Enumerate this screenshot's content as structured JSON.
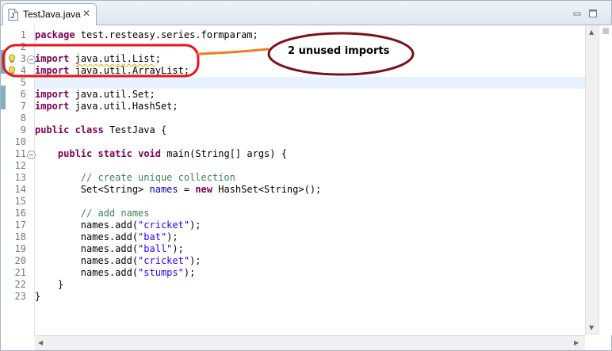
{
  "tab": {
    "title": "TestJava.java",
    "icon": "java-file-icon",
    "close_glyph": "✕"
  },
  "window_controls": [
    "minimize-icon",
    "maximize-icon"
  ],
  "gutter": {
    "warning_lines": [
      3,
      4
    ],
    "fold_lines": [
      3,
      11
    ],
    "current_line": 5
  },
  "code_lines": [
    {
      "n": "1",
      "segments": [
        {
          "text": "package",
          "cls": "kw"
        },
        {
          "text": " test.resteasy.series.formparam;",
          "cls": ""
        }
      ]
    },
    {
      "n": "2",
      "segments": []
    },
    {
      "n": "3",
      "segments": [
        {
          "text": "import",
          "cls": "kw"
        },
        {
          "text": " ",
          "cls": ""
        },
        {
          "text": "java.util.List",
          "cls": "unused"
        },
        {
          "text": ";",
          "cls": ""
        }
      ]
    },
    {
      "n": "4",
      "segments": [
        {
          "text": "import",
          "cls": "kw"
        },
        {
          "text": " ",
          "cls": ""
        },
        {
          "text": "java.util.ArrayList",
          "cls": "unused"
        },
        {
          "text": ";",
          "cls": ""
        }
      ]
    },
    {
      "n": "5",
      "segments": []
    },
    {
      "n": "6",
      "segments": [
        {
          "text": "import",
          "cls": "kw"
        },
        {
          "text": " java.util.Set;",
          "cls": ""
        }
      ]
    },
    {
      "n": "7",
      "segments": [
        {
          "text": "import",
          "cls": "kw"
        },
        {
          "text": " java.util.HashSet;",
          "cls": ""
        }
      ]
    },
    {
      "n": "8",
      "segments": []
    },
    {
      "n": "9",
      "segments": [
        {
          "text": "public",
          "cls": "kw"
        },
        {
          "text": " ",
          "cls": ""
        },
        {
          "text": "class",
          "cls": "kw"
        },
        {
          "text": " TestJava {",
          "cls": ""
        }
      ]
    },
    {
      "n": "10",
      "segments": []
    },
    {
      "n": "11",
      "segments": [
        {
          "text": "    ",
          "cls": ""
        },
        {
          "text": "public",
          "cls": "kw"
        },
        {
          "text": " ",
          "cls": ""
        },
        {
          "text": "static",
          "cls": "kw"
        },
        {
          "text": " ",
          "cls": ""
        },
        {
          "text": "void",
          "cls": "kw"
        },
        {
          "text": " main(String[] args) {",
          "cls": ""
        }
      ]
    },
    {
      "n": "12",
      "segments": []
    },
    {
      "n": "13",
      "segments": [
        {
          "text": "        ",
          "cls": ""
        },
        {
          "text": "// create unique collection",
          "cls": "cm"
        }
      ]
    },
    {
      "n": "14",
      "segments": [
        {
          "text": "        Set<String> ",
          "cls": ""
        },
        {
          "text": "names",
          "cls": "var"
        },
        {
          "text": " = ",
          "cls": ""
        },
        {
          "text": "new",
          "cls": "kw"
        },
        {
          "text": " HashSet<String>();",
          "cls": ""
        }
      ]
    },
    {
      "n": "15",
      "segments": []
    },
    {
      "n": "16",
      "segments": [
        {
          "text": "        ",
          "cls": ""
        },
        {
          "text": "// add names",
          "cls": "cm"
        }
      ]
    },
    {
      "n": "17",
      "segments": [
        {
          "text": "        names.add(",
          "cls": ""
        },
        {
          "text": "\"cricket\"",
          "cls": "str"
        },
        {
          "text": ");",
          "cls": ""
        }
      ]
    },
    {
      "n": "18",
      "segments": [
        {
          "text": "        names.add(",
          "cls": ""
        },
        {
          "text": "\"bat\"",
          "cls": "str"
        },
        {
          "text": ");",
          "cls": ""
        }
      ]
    },
    {
      "n": "19",
      "segments": [
        {
          "text": "        names.add(",
          "cls": ""
        },
        {
          "text": "\"ball\"",
          "cls": "str"
        },
        {
          "text": ");",
          "cls": ""
        }
      ]
    },
    {
      "n": "20",
      "segments": [
        {
          "text": "        names.add(",
          "cls": ""
        },
        {
          "text": "\"cricket\"",
          "cls": "str"
        },
        {
          "text": ");",
          "cls": ""
        }
      ]
    },
    {
      "n": "21",
      "segments": [
        {
          "text": "        names.add(",
          "cls": ""
        },
        {
          "text": "\"stumps\"",
          "cls": "str"
        },
        {
          "text": ");",
          "cls": ""
        }
      ]
    },
    {
      "n": "22",
      "segments": [
        {
          "text": "    }",
          "cls": ""
        }
      ]
    },
    {
      "n": "23",
      "segments": [
        {
          "text": "}",
          "cls": ""
        }
      ]
    }
  ],
  "annotation": {
    "label": "2 unused imports",
    "highlight_color": "#e8141c",
    "ellipse_color": "#7d0f1a",
    "connector_color": "#f07c1e"
  },
  "colors": {
    "keyword": "#7f0055",
    "comment": "#3f7f5f",
    "string": "#2a00ff",
    "field": "#0000c0",
    "line_number": "#787878",
    "current_line": "#e8f2fe",
    "marker": "#7fb0b9"
  }
}
